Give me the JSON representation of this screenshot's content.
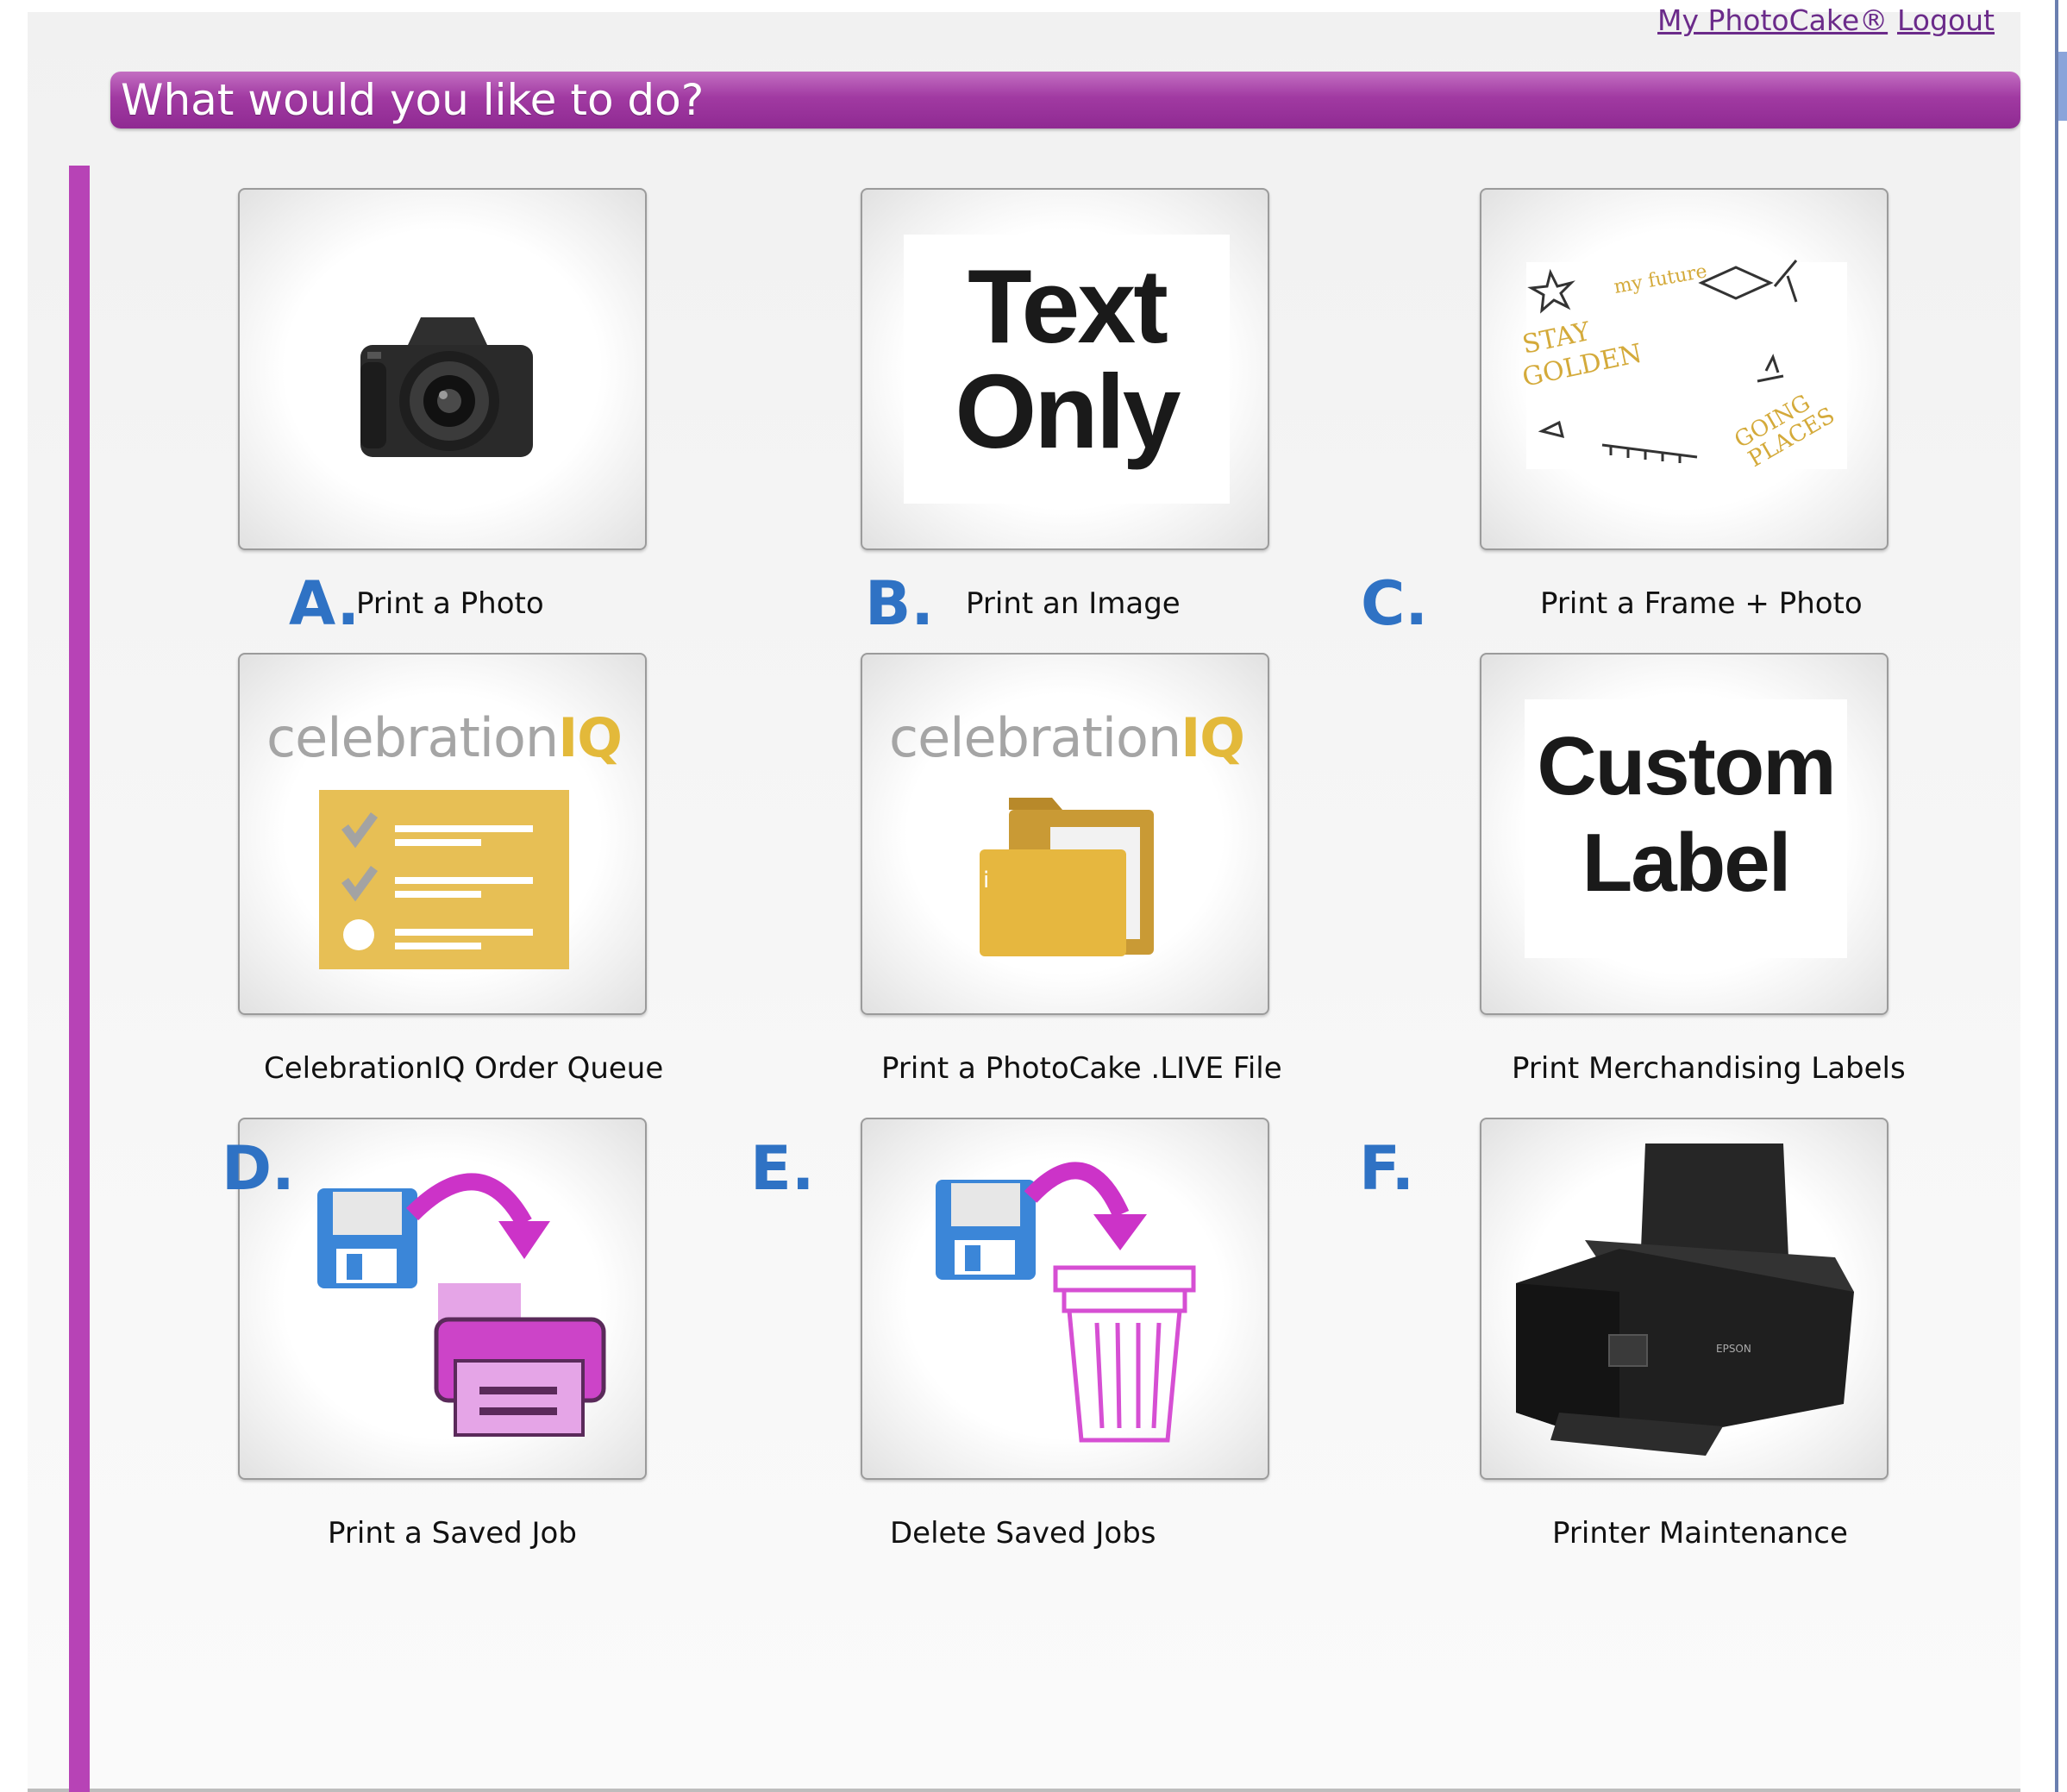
{
  "header": {
    "title": "What would you like to do?",
    "links": {
      "my_photocake": "My PhotoCake®",
      "logout": "Logout"
    }
  },
  "tiles": [
    {
      "caption": "Print a Photo",
      "marker": "A.",
      "icon": "camera-icon"
    },
    {
      "caption": "Print an Image",
      "marker": "B.",
      "icon": "text-only-icon",
      "art_text": [
        "Text",
        "Only"
      ]
    },
    {
      "caption": "Print a Frame + Photo",
      "marker": "C.",
      "icon": "frame-icon"
    },
    {
      "caption": "CelebrationIQ Order Queue",
      "icon": "checklist-icon",
      "art_text": [
        "celebration",
        "IQ"
      ]
    },
    {
      "caption": "Print a PhotoCake .LIVE File",
      "icon": "folder-icon",
      "art_text": [
        "celebration",
        "IQ"
      ]
    },
    {
      "caption": "Print Merchandising Labels",
      "icon": "custom-label-icon",
      "art_text": [
        "Custom",
        "Label"
      ]
    },
    {
      "caption": "Print a Saved Job",
      "marker": "D.",
      "icon": "floppy-to-printer-icon"
    },
    {
      "caption": "Delete Saved Jobs",
      "marker": "E.",
      "icon": "floppy-to-trash-icon"
    },
    {
      "caption": "Printer Maintenance",
      "marker": "F.",
      "icon": "printer-icon"
    }
  ],
  "colors": {
    "header_purple": "#a13aa2",
    "accent_magenta": "#b743b6",
    "marker_blue": "#2f72c4",
    "ciq_gold": "#e3b93a"
  }
}
